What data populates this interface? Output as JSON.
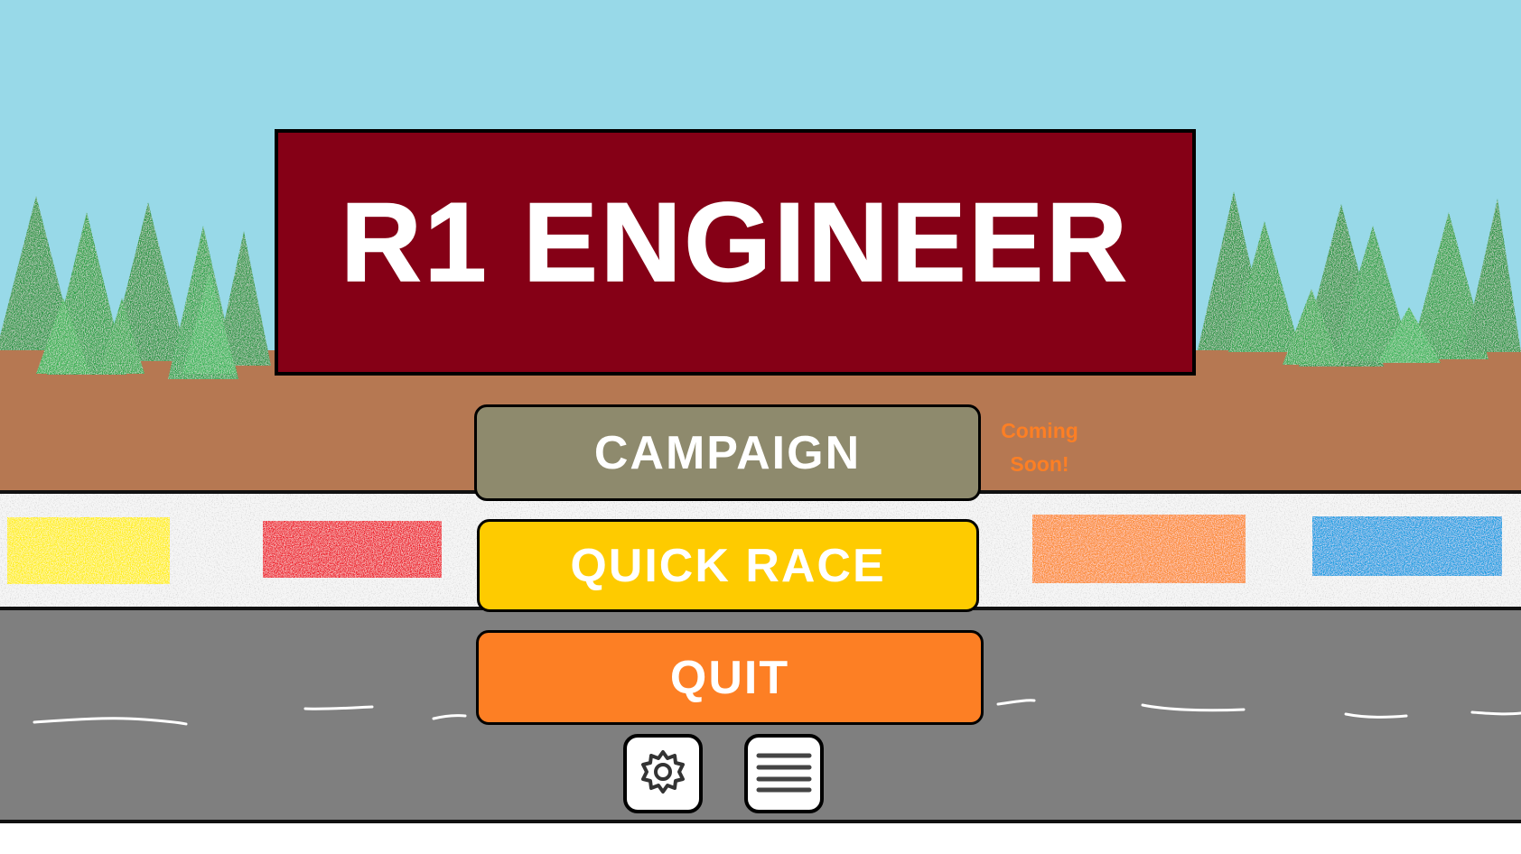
{
  "title": "R1 ENGINEER",
  "menu": {
    "campaign_label": "CAMPAIGN",
    "campaign_note": "Coming Soon!",
    "quick_race_label": "QUICK RACE",
    "quit_label": "QUIT"
  },
  "icons": {
    "settings": "gear-icon",
    "menu": "hamburger-menu-icon"
  },
  "colors": {
    "sky": "#98d9e8",
    "dirt": "#b67852",
    "road": "#7f7f7f",
    "title_bg": "#850016",
    "campaign": "#8e8a6d",
    "quick_race": "#fecb00",
    "quit": "#fd7f24",
    "coming_soon": "#fd7f24",
    "team_yellow": "#ffef1d",
    "team_red": "#ee2631",
    "team_orange": "#fc8c35",
    "team_blue": "#1d9fe2",
    "tree": "#2ca24a"
  }
}
